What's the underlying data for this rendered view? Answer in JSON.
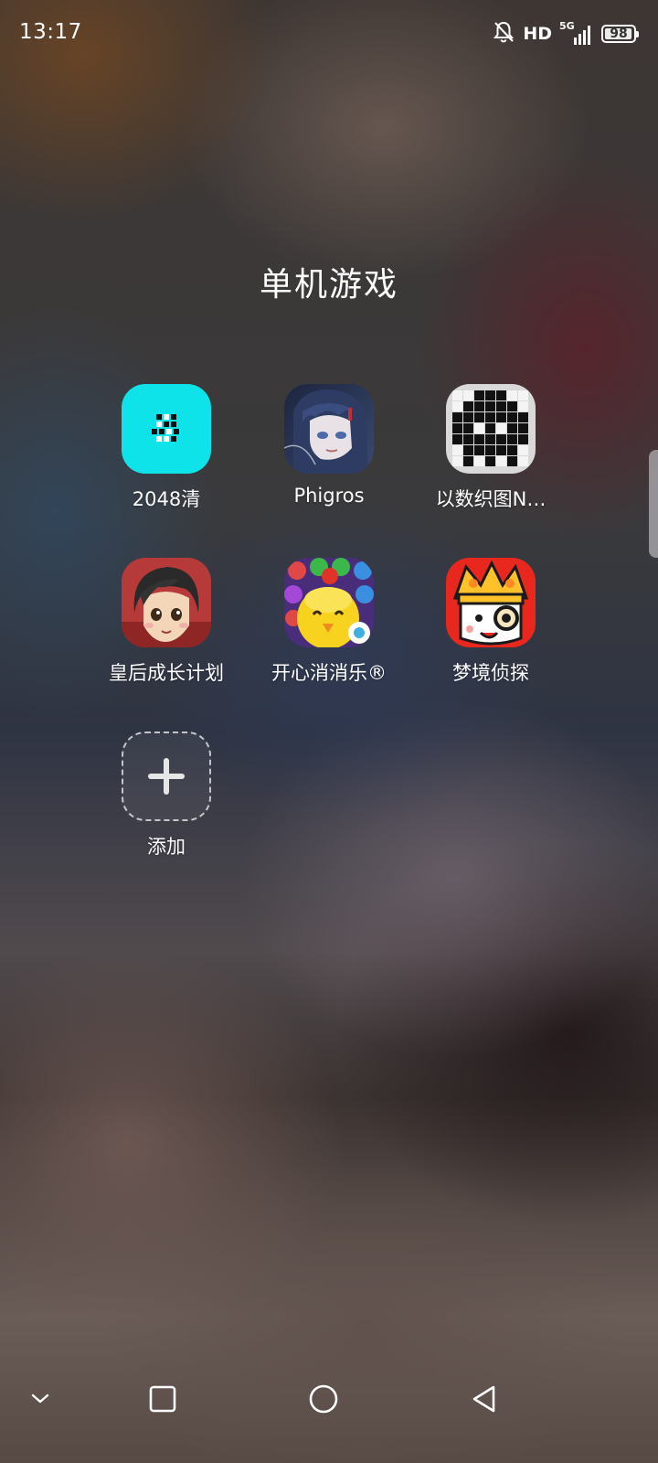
{
  "status_bar": {
    "time": "13:17",
    "network_label": "HD",
    "signal_label": "5G",
    "battery_level": "98",
    "icons": [
      "bell-off-icon",
      "signal-icon",
      "battery-icon"
    ]
  },
  "folder": {
    "title": "单机游戏"
  },
  "apps": [
    {
      "label": "2048清",
      "icon": "app-2048-icon"
    },
    {
      "label": "Phigros",
      "icon": "app-phigros-icon"
    },
    {
      "label": "以数织图N…",
      "icon": "app-nonogram-icon"
    },
    {
      "label": "皇后成长计划",
      "icon": "app-queen-icon"
    },
    {
      "label": "开心消消乐®",
      "icon": "app-happy-match-icon"
    },
    {
      "label": "梦境侦探",
      "icon": "app-dream-detective-icon"
    },
    {
      "label": "添加",
      "icon": "add-icon"
    }
  ],
  "nav_bar": {
    "icons": [
      "chevron-down-icon",
      "recents-icon",
      "home-icon",
      "back-icon"
    ]
  },
  "colors": {
    "icon_2048_bg": "#0fe3ea",
    "text": "#ffffff"
  }
}
